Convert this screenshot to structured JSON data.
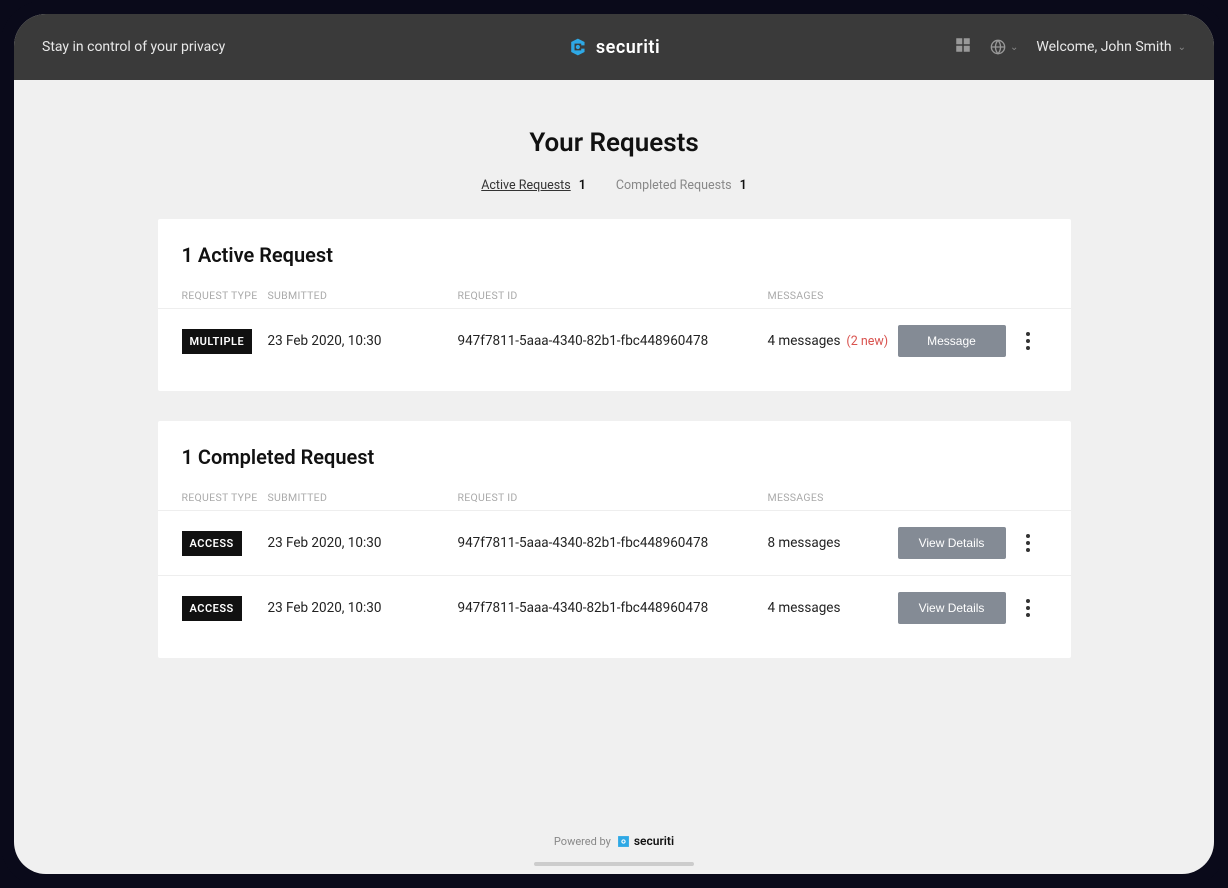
{
  "header": {
    "tagline": "Stay in control of your privacy",
    "brand": "securiti",
    "welcome": "Welcome, John Smith"
  },
  "page": {
    "title": "Your Requests"
  },
  "tabs": {
    "active": {
      "label": "Active Requests",
      "count": "1"
    },
    "completed": {
      "label": "Completed Requests",
      "count": "1"
    }
  },
  "activeSection": {
    "title": "1 Active Request",
    "columns": {
      "type": "REQUEST TYPE",
      "submitted": "SUBMITTED",
      "id": "REQUEST ID",
      "messages": "MESSAGES"
    },
    "rows": [
      {
        "badge": "MULTIPLE",
        "submitted": "23 Feb 2020, 10:30",
        "id": "947f7811-5aaa-4340-82b1-fbc448960478",
        "messages": "4 messages",
        "new": "(2 new)",
        "action": "Message"
      }
    ]
  },
  "completedSection": {
    "title": "1 Completed Request",
    "columns": {
      "type": "REQUEST TYPE",
      "submitted": "SUBMITTED",
      "id": "REQUEST ID",
      "messages": "MESSAGES"
    },
    "rows": [
      {
        "badge": "ACCESS",
        "submitted": "23 Feb 2020, 10:30",
        "id": "947f7811-5aaa-4340-82b1-fbc448960478",
        "messages": "8 messages",
        "action": "View Details"
      },
      {
        "badge": "ACCESS",
        "submitted": "23 Feb 2020, 10:30",
        "id": "947f7811-5aaa-4340-82b1-fbc448960478",
        "messages": "4 messages",
        "action": "View Details"
      }
    ]
  },
  "footer": {
    "powered": "Powered by",
    "brand": "securiti"
  }
}
